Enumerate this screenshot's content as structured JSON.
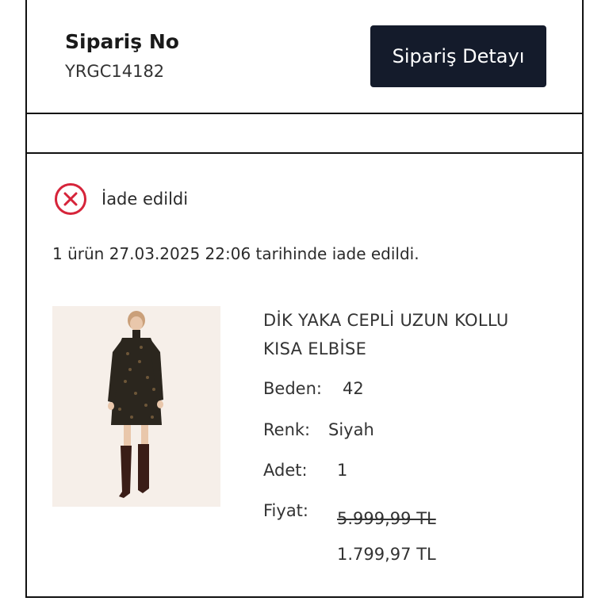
{
  "order": {
    "label": "Sipariş No",
    "number": "YRGC14182",
    "detail_button": "Sipariş Detayı"
  },
  "status": {
    "icon": "x-circle-icon",
    "icon_color": "#d6243a",
    "text": "İade edildi",
    "info": "1 ürün 27.03.2025 22:06 tarihinde iade edildi."
  },
  "product": {
    "name": "DİK YAKA CEPLİ UZUN KOLLU KISA ELBİSE",
    "size_label": "Beden:",
    "size_value": "42",
    "color_label": "Renk:",
    "color_value": "Siyah",
    "qty_label": "Adet:",
    "qty_value": "1",
    "price_label": "Fiyat:",
    "old_price": "5.999,99 TL",
    "new_price": "1.799,97 TL"
  },
  "colors": {
    "button_bg": "#141b2b",
    "border": "#111111"
  }
}
